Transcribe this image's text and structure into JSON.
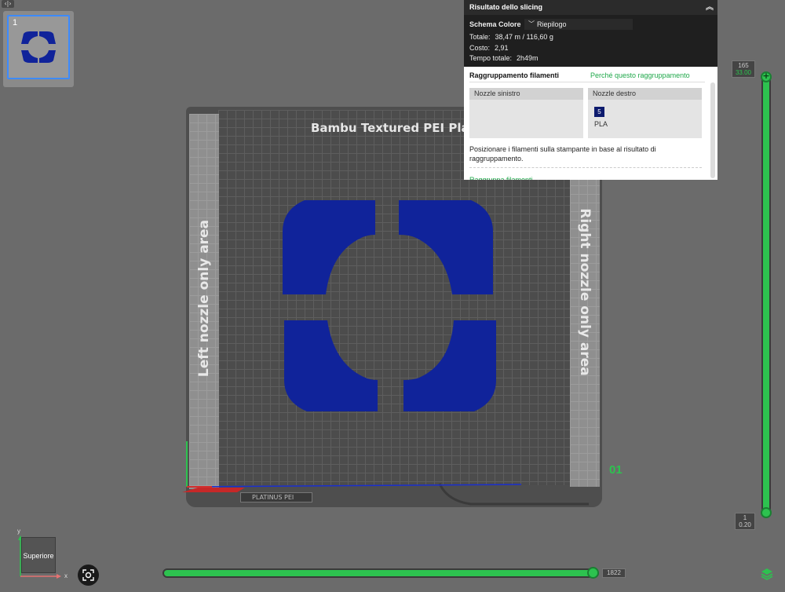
{
  "toolbar": {
    "collapse_glyph": "‹|›"
  },
  "plates": {
    "items": [
      {
        "number": "1"
      }
    ]
  },
  "bed": {
    "title": "Bambu Textured PEI Plate",
    "left_area_label": "Left nozzle only area",
    "right_area_label": "Right nozzle only area",
    "plate_number": "01",
    "logo_text": "PLATINUS PEI",
    "part_color": "#10239a"
  },
  "slicing": {
    "header": "Risultato dello slicing",
    "collapse_icon": "chevron-up-double-icon",
    "color_scheme_label": "Schema Colore",
    "color_scheme_value": "Riepilogo",
    "stats": [
      {
        "key": "Totale:",
        "value": "38,47 m / 116,60 g"
      },
      {
        "key": "Costo:",
        "value": "2,91"
      },
      {
        "key": "Tempo totale:",
        "value": "2h49m"
      }
    ]
  },
  "grouping": {
    "title": "Raggruppamento filamenti",
    "why_link": "Perché questo raggruppamento",
    "left_nozzle": "Nozzle sinistro",
    "right_nozzle": "Nozzle destro",
    "filament_id": "5",
    "filament_type": "PLA",
    "filament_color": "#0d1b6e",
    "description": "Posizionare i filamenti sulla stampante in base al risultato di raggruppamento.",
    "cut_link": "Raggruppa filamenti"
  },
  "layer_slider": {
    "top_layer": "165",
    "top_height": "33.00",
    "bottom_layer": "1",
    "bottom_height": "0.20",
    "accent": "#2dc24f"
  },
  "move_slider": {
    "value": "1822"
  },
  "view": {
    "orientation_label": "Superiore",
    "axis_y": "y",
    "axis_x": "x"
  }
}
